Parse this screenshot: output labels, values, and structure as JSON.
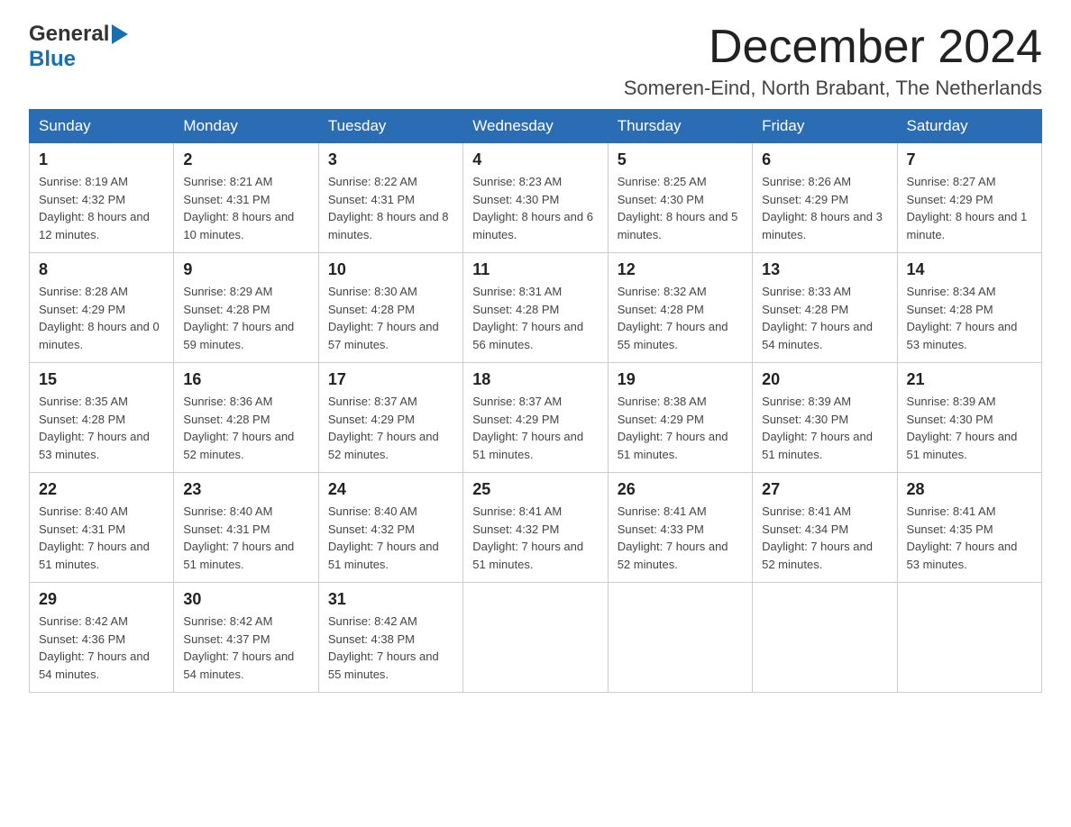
{
  "header": {
    "logo": {
      "general": "General",
      "blue": "Blue",
      "arrow_char": "▶"
    },
    "title": "December 2024",
    "location": "Someren-Eind, North Brabant, The Netherlands"
  },
  "weekdays": [
    "Sunday",
    "Monday",
    "Tuesday",
    "Wednesday",
    "Thursday",
    "Friday",
    "Saturday"
  ],
  "weeks": [
    [
      {
        "day": "1",
        "sunrise": "Sunrise: 8:19 AM",
        "sunset": "Sunset: 4:32 PM",
        "daylight": "Daylight: 8 hours and 12 minutes."
      },
      {
        "day": "2",
        "sunrise": "Sunrise: 8:21 AM",
        "sunset": "Sunset: 4:31 PM",
        "daylight": "Daylight: 8 hours and 10 minutes."
      },
      {
        "day": "3",
        "sunrise": "Sunrise: 8:22 AM",
        "sunset": "Sunset: 4:31 PM",
        "daylight": "Daylight: 8 hours and 8 minutes."
      },
      {
        "day": "4",
        "sunrise": "Sunrise: 8:23 AM",
        "sunset": "Sunset: 4:30 PM",
        "daylight": "Daylight: 8 hours and 6 minutes."
      },
      {
        "day": "5",
        "sunrise": "Sunrise: 8:25 AM",
        "sunset": "Sunset: 4:30 PM",
        "daylight": "Daylight: 8 hours and 5 minutes."
      },
      {
        "day": "6",
        "sunrise": "Sunrise: 8:26 AM",
        "sunset": "Sunset: 4:29 PM",
        "daylight": "Daylight: 8 hours and 3 minutes."
      },
      {
        "day": "7",
        "sunrise": "Sunrise: 8:27 AM",
        "sunset": "Sunset: 4:29 PM",
        "daylight": "Daylight: 8 hours and 1 minute."
      }
    ],
    [
      {
        "day": "8",
        "sunrise": "Sunrise: 8:28 AM",
        "sunset": "Sunset: 4:29 PM",
        "daylight": "Daylight: 8 hours and 0 minutes."
      },
      {
        "day": "9",
        "sunrise": "Sunrise: 8:29 AM",
        "sunset": "Sunset: 4:28 PM",
        "daylight": "Daylight: 7 hours and 59 minutes."
      },
      {
        "day": "10",
        "sunrise": "Sunrise: 8:30 AM",
        "sunset": "Sunset: 4:28 PM",
        "daylight": "Daylight: 7 hours and 57 minutes."
      },
      {
        "day": "11",
        "sunrise": "Sunrise: 8:31 AM",
        "sunset": "Sunset: 4:28 PM",
        "daylight": "Daylight: 7 hours and 56 minutes."
      },
      {
        "day": "12",
        "sunrise": "Sunrise: 8:32 AM",
        "sunset": "Sunset: 4:28 PM",
        "daylight": "Daylight: 7 hours and 55 minutes."
      },
      {
        "day": "13",
        "sunrise": "Sunrise: 8:33 AM",
        "sunset": "Sunset: 4:28 PM",
        "daylight": "Daylight: 7 hours and 54 minutes."
      },
      {
        "day": "14",
        "sunrise": "Sunrise: 8:34 AM",
        "sunset": "Sunset: 4:28 PM",
        "daylight": "Daylight: 7 hours and 53 minutes."
      }
    ],
    [
      {
        "day": "15",
        "sunrise": "Sunrise: 8:35 AM",
        "sunset": "Sunset: 4:28 PM",
        "daylight": "Daylight: 7 hours and 53 minutes."
      },
      {
        "day": "16",
        "sunrise": "Sunrise: 8:36 AM",
        "sunset": "Sunset: 4:28 PM",
        "daylight": "Daylight: 7 hours and 52 minutes."
      },
      {
        "day": "17",
        "sunrise": "Sunrise: 8:37 AM",
        "sunset": "Sunset: 4:29 PM",
        "daylight": "Daylight: 7 hours and 52 minutes."
      },
      {
        "day": "18",
        "sunrise": "Sunrise: 8:37 AM",
        "sunset": "Sunset: 4:29 PM",
        "daylight": "Daylight: 7 hours and 51 minutes."
      },
      {
        "day": "19",
        "sunrise": "Sunrise: 8:38 AM",
        "sunset": "Sunset: 4:29 PM",
        "daylight": "Daylight: 7 hours and 51 minutes."
      },
      {
        "day": "20",
        "sunrise": "Sunrise: 8:39 AM",
        "sunset": "Sunset: 4:30 PM",
        "daylight": "Daylight: 7 hours and 51 minutes."
      },
      {
        "day": "21",
        "sunrise": "Sunrise: 8:39 AM",
        "sunset": "Sunset: 4:30 PM",
        "daylight": "Daylight: 7 hours and 51 minutes."
      }
    ],
    [
      {
        "day": "22",
        "sunrise": "Sunrise: 8:40 AM",
        "sunset": "Sunset: 4:31 PM",
        "daylight": "Daylight: 7 hours and 51 minutes."
      },
      {
        "day": "23",
        "sunrise": "Sunrise: 8:40 AM",
        "sunset": "Sunset: 4:31 PM",
        "daylight": "Daylight: 7 hours and 51 minutes."
      },
      {
        "day": "24",
        "sunrise": "Sunrise: 8:40 AM",
        "sunset": "Sunset: 4:32 PM",
        "daylight": "Daylight: 7 hours and 51 minutes."
      },
      {
        "day": "25",
        "sunrise": "Sunrise: 8:41 AM",
        "sunset": "Sunset: 4:32 PM",
        "daylight": "Daylight: 7 hours and 51 minutes."
      },
      {
        "day": "26",
        "sunrise": "Sunrise: 8:41 AM",
        "sunset": "Sunset: 4:33 PM",
        "daylight": "Daylight: 7 hours and 52 minutes."
      },
      {
        "day": "27",
        "sunrise": "Sunrise: 8:41 AM",
        "sunset": "Sunset: 4:34 PM",
        "daylight": "Daylight: 7 hours and 52 minutes."
      },
      {
        "day": "28",
        "sunrise": "Sunrise: 8:41 AM",
        "sunset": "Sunset: 4:35 PM",
        "daylight": "Daylight: 7 hours and 53 minutes."
      }
    ],
    [
      {
        "day": "29",
        "sunrise": "Sunrise: 8:42 AM",
        "sunset": "Sunset: 4:36 PM",
        "daylight": "Daylight: 7 hours and 54 minutes."
      },
      {
        "day": "30",
        "sunrise": "Sunrise: 8:42 AM",
        "sunset": "Sunset: 4:37 PM",
        "daylight": "Daylight: 7 hours and 54 minutes."
      },
      {
        "day": "31",
        "sunrise": "Sunrise: 8:42 AM",
        "sunset": "Sunset: 4:38 PM",
        "daylight": "Daylight: 7 hours and 55 minutes."
      },
      null,
      null,
      null,
      null
    ]
  ]
}
